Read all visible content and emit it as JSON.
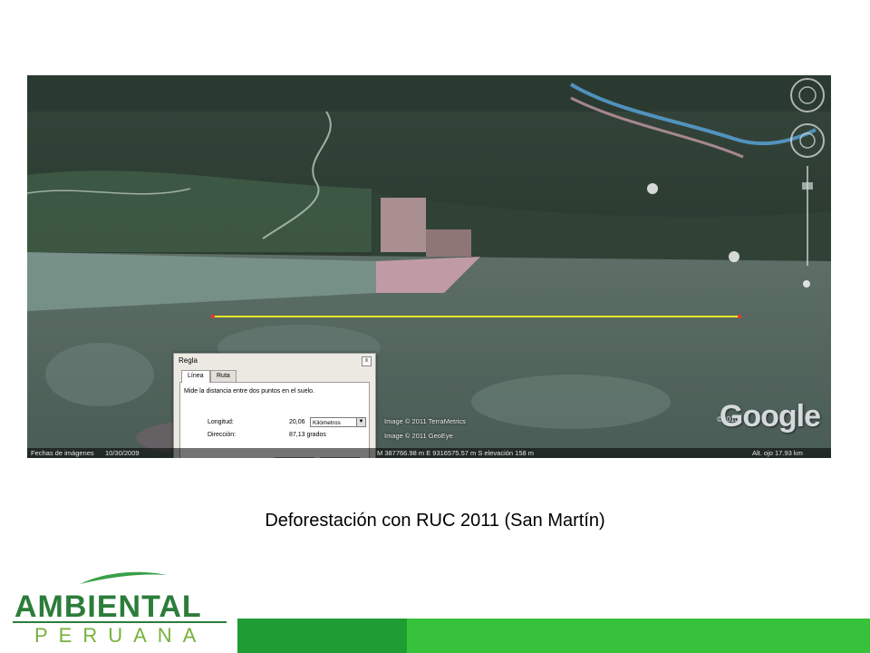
{
  "map": {
    "status": {
      "dates_label": "Fechas de imágenes",
      "dates_value": "10/30/2009",
      "coords": "M 387766.98 m E 9316575.57 m S elevación  158 m",
      "altitude": "Alt. ojo    17.93 km"
    },
    "credits": {
      "terrametrics": "Image © 2011 TerraMetrics",
      "geoeye": "Image © 2011 GeoEye",
      "year": "©2010"
    },
    "brand": "Google"
  },
  "ruler_dialog": {
    "title": "Regla",
    "tabs": [
      "Línea",
      "Ruta"
    ],
    "active_tab": "Línea",
    "description": "Mide la distancia entre dos puntos en el suelo.",
    "length_label": "Longitud:",
    "length_value": "20,06",
    "unit": "Kilómetros",
    "direction_label": "Dirección:",
    "direction_value": "87,13 grados"
  },
  "caption": "Deforestación con RUC 2011 (San Martín)",
  "logo": {
    "line1": "AMBIENTAL",
    "line2": "PERUANA"
  },
  "colors": {
    "logo_green": "#2c7d3a",
    "logo_light_green": "#76b23a",
    "band_dark": "#1f9c34",
    "band_light": "#37c23b",
    "ruler_line": "#e8e82a"
  }
}
